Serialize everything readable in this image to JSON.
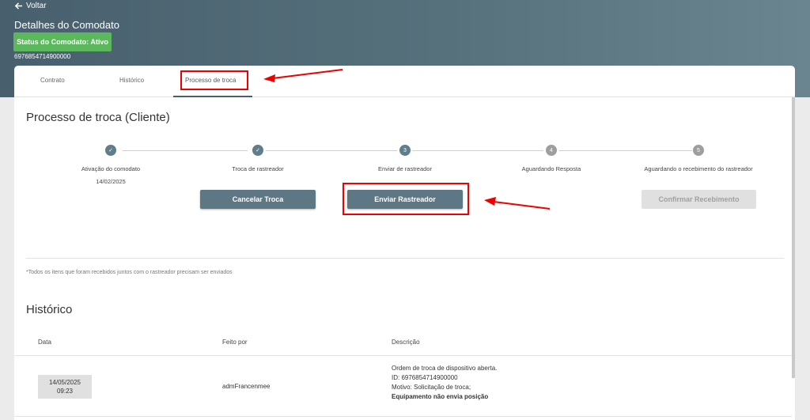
{
  "header": {
    "back_label": "Voltar",
    "title": "Detalhes do Comodato",
    "status_label": "Status do Comodato: Ativo",
    "id": "6976854714900000"
  },
  "tabs": [
    {
      "label": "Contrato"
    },
    {
      "label": "Histórico"
    },
    {
      "label": "Processo de troca",
      "active": true
    }
  ],
  "process": {
    "title": "Processo de troca (Cliente)",
    "steps": [
      {
        "number": "✓",
        "label": "Ativação do comodato",
        "date": "14/02/2025",
        "state": "done"
      },
      {
        "number": "✓",
        "label": "Troca de rastreador",
        "date": "",
        "state": "done"
      },
      {
        "number": "3",
        "label": "Enviar de rastreador",
        "date": "",
        "state": "current"
      },
      {
        "number": "4",
        "label": "Aguardando Resposta",
        "date": "",
        "state": "pending"
      },
      {
        "number": "5",
        "label": "Aguardando o recebimento do rastreador",
        "date": "",
        "state": "pending"
      }
    ],
    "buttons": {
      "cancel": "Cancelar Troca",
      "send": "Enviar Rastreador",
      "confirm": "Confirmar Recebimento"
    },
    "note": "*Todos os itens que foram recebidos juntos com o rastreador precisam ser enviados"
  },
  "history": {
    "title": "Histórico",
    "columns": [
      "Data",
      "Feito por",
      "Descrição"
    ],
    "rows": [
      {
        "date": "14/05/2025",
        "time": "09:23",
        "by": "admFrancenmee",
        "description": [
          "Ordem de troca de dispositivo aberta.",
          "ID: 6976854714900000",
          "Motivo: Solicitação de troca;",
          "Equipamento não envia posição"
        ]
      }
    ]
  },
  "colors": {
    "header": "#56707c",
    "status_green": "#5cb85c",
    "primary_button": "#5e7784",
    "highlight_red": "#e00000"
  }
}
